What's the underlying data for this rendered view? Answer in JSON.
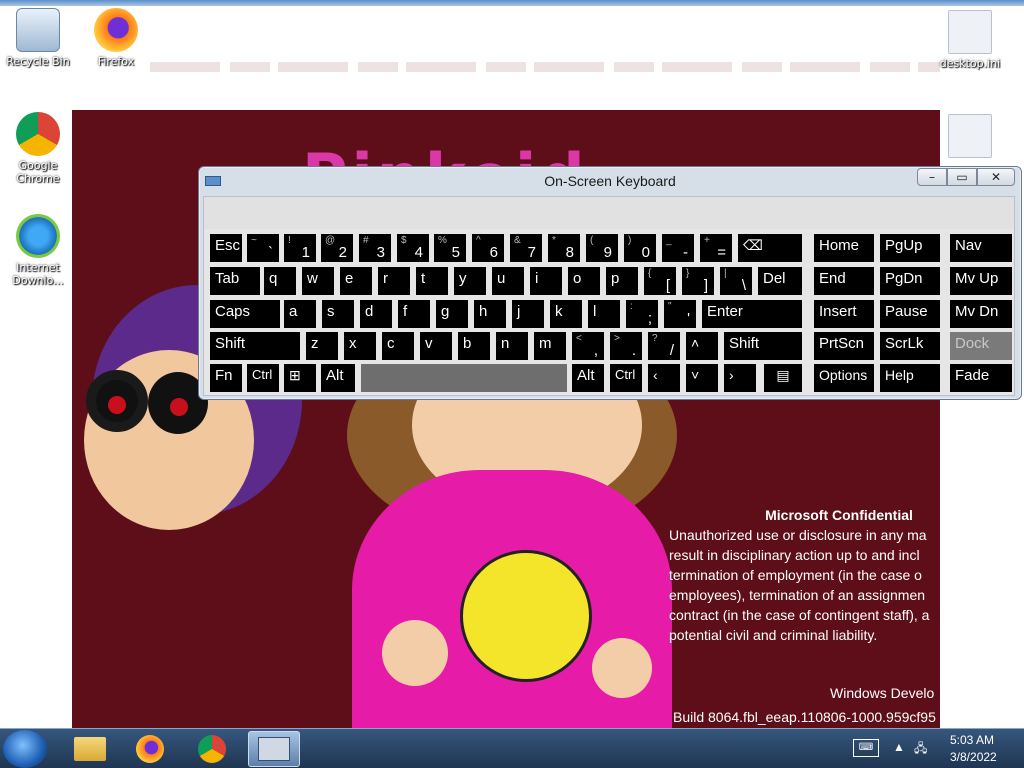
{
  "desktop": {
    "icons": [
      {
        "label": "Recycle Bin"
      },
      {
        "label": "Firefox"
      },
      {
        "label": "Google Chrome"
      },
      {
        "label": "Internet Downlo..."
      },
      {
        "label": "desktop.ini"
      }
    ],
    "bg_title": "Pinkoid"
  },
  "osk": {
    "title": "On-Screen Keyboard",
    "rows": {
      "r1": [
        "Esc",
        "~",
        "`",
        "!",
        "1",
        "@",
        "2",
        "#",
        "3",
        "$",
        "4",
        "%",
        "5",
        "^",
        "6",
        "&",
        "7",
        "*",
        "8",
        "(",
        "9",
        ")",
        "0",
        "_",
        "-",
        "+",
        "="
      ],
      "keys": {
        "esc": "Esc",
        "tab": "Tab",
        "caps": "Caps",
        "shift": "Shift",
        "shift_r": "Shift",
        "fn": "Fn",
        "ctrl": "Ctrl",
        "alt": "Alt",
        "alt_r": "Alt",
        "ctrl_r": "Ctrl",
        "del": "Del",
        "enter": "Enter",
        "home": "Home",
        "pgup": "PgUp",
        "nav": "Nav",
        "end": "End",
        "pgdn": "PgDn",
        "mvup": "Mv Up",
        "insert": "Insert",
        "pause": "Pause",
        "mvdn": "Mv Dn",
        "prtscn": "PrtScn",
        "scrlk": "ScrLk",
        "dock": "Dock",
        "options": "Options",
        "help": "Help",
        "fade": "Fade",
        "q": "q",
        "w": "w",
        "e": "e",
        "r": "r",
        "t": "t",
        "y": "y",
        "u": "u",
        "i": "i",
        "o": "o",
        "p": "p",
        "a": "a",
        "s": "s",
        "d": "d",
        "f": "f",
        "g": "g",
        "h": "h",
        "j": "j",
        "k": "k",
        "l": "l",
        "z": "z",
        "x": "x",
        "c": "c",
        "v": "v",
        "b": "b",
        "n": "n",
        "m": "m",
        "br_open_sub": "{",
        "br_open": "[",
        "br_close_sub": "}",
        "br_close": "]",
        "pipe_sub": "|",
        "pipe": "\\",
        "colon_sub": ":",
        "semi": ";",
        "quote_sub": "\"",
        "quote": "'",
        "lt_sub": "<",
        "comma": ",",
        "gt_sub": ">",
        "period": ".",
        "q_sub": "?",
        "slash": "/"
      }
    }
  },
  "confidential": {
    "heading": "Microsoft Confidential",
    "lines": [
      "Unauthorized use or disclosure in any ma",
      "result in disciplinary action up to and incl",
      "termination of employment (in the case o",
      "employees), termination of an assignmen",
      "contract (in the case of contingent staff), a",
      "potential civil and criminal liability."
    ]
  },
  "build": {
    "line1": "Windows Develo",
    "line2": "Build 8064.fbl_eeap.110806-1000.959cf95"
  },
  "tray": {
    "time": "5:03 AM",
    "date": "3/8/2022"
  }
}
